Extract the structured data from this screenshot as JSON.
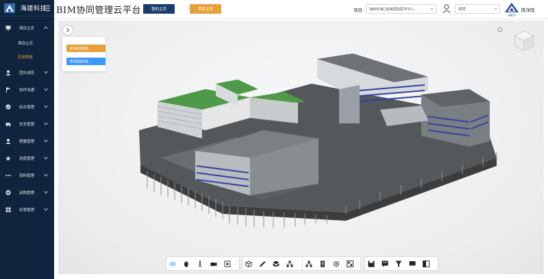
{
  "sidebar": {
    "brand": "海建科技",
    "items": [
      {
        "label": "项目主页",
        "icon": "monitor-icon",
        "expanded": true
      },
      {
        "label": "团队成员",
        "icon": "person-icon"
      },
      {
        "label": "协作沟通",
        "icon": "flag-icon"
      },
      {
        "label": "综合管理",
        "icon": "check-circle-icon"
      },
      {
        "label": "安全管理",
        "icon": "truck-icon"
      },
      {
        "label": "质量管理",
        "icon": "person-badge-icon"
      },
      {
        "label": "进度管理",
        "icon": "star-icon"
      },
      {
        "label": "资料管理",
        "icon": "dots-icon"
      },
      {
        "label": "采购管理",
        "icon": "plus-circle-icon"
      },
      {
        "label": "实景管理",
        "icon": "grid-icon"
      }
    ],
    "sub_items": [
      {
        "label": "项目主页",
        "active": false
      },
      {
        "label": "应用导航",
        "active": true
      }
    ]
  },
  "header": {
    "title": "BIM协同管理云平台",
    "home_button": "我的主页",
    "project_button": "项目主页",
    "project_label": "项目:",
    "project_value": "海南省海囗成美国际医学中心...",
    "role_value": "成员",
    "user_name": "陈洋阳",
    "brand_short": "HNCP"
  },
  "viewport": {
    "panel_buttons": [
      "建成美国际医...",
      "建成美国际医..."
    ]
  },
  "toolbar": {
    "groups": [
      [
        "orbit-icon",
        "pan-hand-icon",
        "walk-person-icon",
        "camera-icon",
        "fit-view-icon"
      ],
      [
        "section-box-icon",
        "measure-ruler-icon",
        "explode-icon",
        "model-tree-icon"
      ],
      [
        "hierarchy-icon",
        "properties-icon",
        "settings-gear-icon",
        "fullscreen-icon"
      ],
      [
        "save-icon",
        "annotate-icon",
        "filter-icon",
        "comment-icon",
        "split-view-icon"
      ]
    ]
  },
  "colors": {
    "sidebar_bg": "#10253d",
    "accent_orange": "#e8a03b",
    "accent_blue": "#3b98f5",
    "primary_navy": "#1c3d6b",
    "active_sub": "#f0a13a"
  }
}
